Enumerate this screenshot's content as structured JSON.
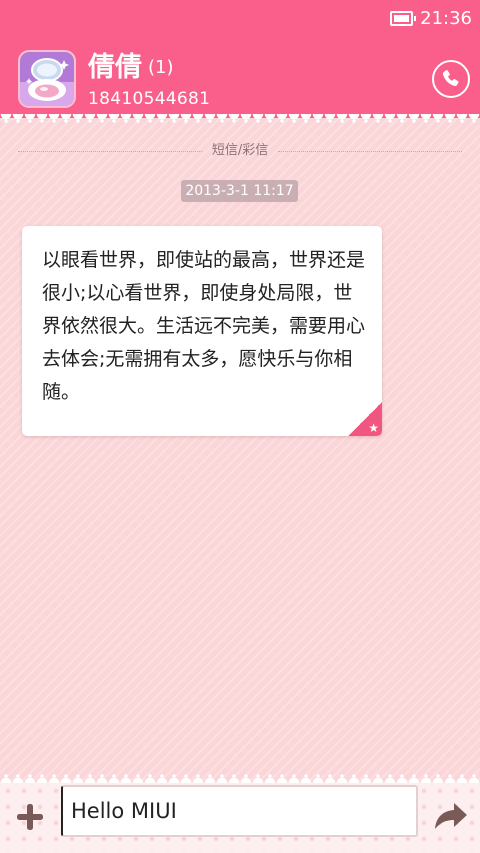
{
  "status_bar": {
    "time": "21:36",
    "battery_icon": "battery-icon"
  },
  "header": {
    "contact_name": "倩倩",
    "unread_count": "(1)",
    "phone_number": "18410544681",
    "avatar_icon": "makeup-compact-icon",
    "call_icon": "phone-icon",
    "background_color": "#fa5f8b"
  },
  "conversation": {
    "channel_label": "短信/彩信",
    "timestamp": "2013-3-1 11:17",
    "message": {
      "text": "以眼看世界，即使站的最高，世界还是很小;以心看世界，即使身处局限，世界依然很大。生活远不完美，需要用心去体会;无需拥有太多，愿快乐与你相随。",
      "starred_icon": "star-icon"
    }
  },
  "compose": {
    "input_value": "Hello MIUI",
    "attach_icon": "plus-icon",
    "send_icon": "send-arrow-icon"
  }
}
